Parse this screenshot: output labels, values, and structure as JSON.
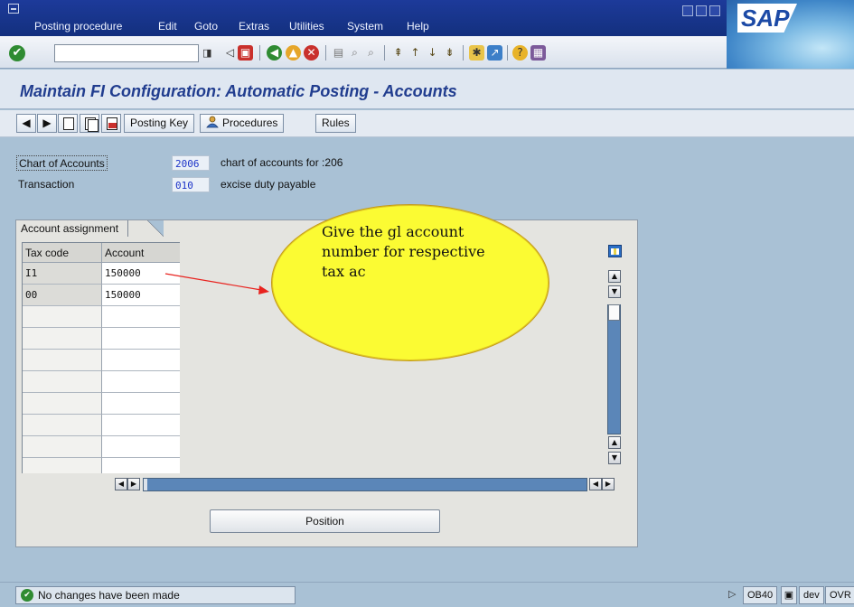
{
  "menubar": {
    "items": [
      "Posting procedure",
      "Edit",
      "Goto",
      "Extras",
      "Utilities",
      "System",
      "Help"
    ]
  },
  "logo": {
    "text": "SAP"
  },
  "page": {
    "title": "Maintain FI Configuration: Automatic Posting - Accounts"
  },
  "apptoolbar": {
    "posting_key_label": "Posting Key",
    "procedures_label": "Procedures",
    "rules_label": "Rules"
  },
  "header": {
    "chart_label": "Chart of Accounts",
    "chart_value": "2006",
    "chart_desc": "chart of accounts for :206",
    "transaction_label": "Transaction",
    "transaction_value": "010",
    "transaction_desc": "excise duty payable"
  },
  "assignment": {
    "tab_label": "Account assignment",
    "columns": [
      "Tax code",
      "Account"
    ],
    "rows": [
      {
        "tax_code": "I1",
        "account": "150000"
      },
      {
        "tax_code": "00",
        "account": "150000"
      }
    ]
  },
  "annotation": {
    "text": "Give the gl account number for respective tax ac"
  },
  "position_label": "Position",
  "status": {
    "message": "No changes have been made",
    "tcode": "OB40",
    "client": "dev",
    "mode": "OVR"
  },
  "colors": {
    "background": "#a9c1d5",
    "title": "#213d8f",
    "bubble": "#fbfb33",
    "arrow": "#e8231f"
  }
}
